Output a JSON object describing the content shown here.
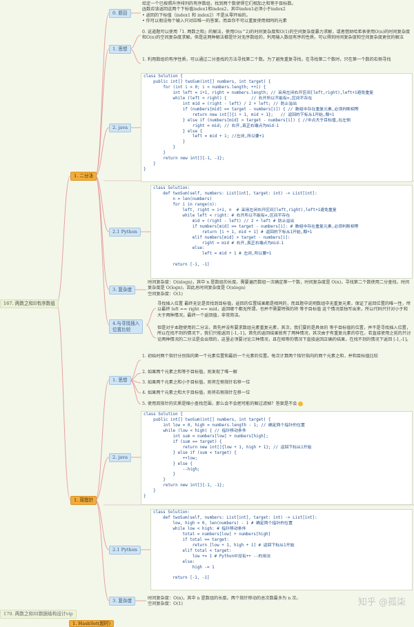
{
  "root": {
    "title": "167. 两数之和II有序数组"
  },
  "branch1": {
    "title": "1. 二分法",
    "question": {
      "label": "0. 题目",
      "line1": "给定一个已按照升序排列的有序数组，找到两个数使得它们相加之和等于目标数。",
      "line2": "函数应该返回这两个下标值index1和index2，其中index1必须小于index2",
      "bullet1": "返回的下标值（index1 和 index2）不是从零开始的。",
      "bullet2": "你可以假设每个输入只对应唯一的答案，而且你不可以重复使用相同的元素"
    },
    "idea": {
      "label": "1. 思想",
      "p0": "0. 这道题可以使用「1. 两数之和」的解法，使用O(n^2)的时间复杂度和O(1)的空间复杂度暴力求解，或者借助哈希表使用O(n)的时间复杂度和O(n)的空间复杂度求解。但是这两种解法都是针对无序数组的，利用输入数组有序的性质，可以得到时间复杂度和空间复杂度更优的解法",
      "p1": "1. 利用数组的有序性质，可以通过二分查找的方法寻找第二个数。为了避免重复寻找，在寻找第二个数时，只在第一个数的右侧寻找"
    },
    "java": {
      "label": "2. java",
      "code": [
        "class Solution {",
        "    public int[] twoSum(int[] numbers, int target) {",
        "        for (int i = 0; i < numbers.length; ++i) {",
        "            int left = i+1, right = numbers.length; // 采用左闭右开区间[left,right),left+1避免重复",
        "            while (left < right) {          // 右开所以不能有=,区间不存在",
        "                int mid = (right - left) / 2 + left; // 防止溢出",
        "                if (numbers[mid] == target - numbers[i]) { // 数组中存在重复元素,必须判断相等",
        "                    return new int[]{i + 1, mid + 1};   // 返回的下标从1开始,都+1",
        "                } else if (numbers[mid] > target - numbers[i]) { //中点大于目标值,在左侧",
        "                    right = mid; // 右开,真正右端点为mid-1",
        "                } else {",
        "                    left = mid + 1; //左闭,所以要+1",
        "                }",
        "            }",
        "        }",
        "        return new int[]{-1, -1};",
        "    }",
        "}"
      ]
    },
    "python": {
      "label": "2.1 Python",
      "code": [
        "class Solution:",
        "    def twoSum(self, numbers: List[int], target: int) -> List[int]:",
        "        n = len(numbers)",
        "        for i in range(n):",
        "            left, right = i+1, n  # 采用左闭右开区间[left,right),left+1避免重复",
        "            while left < right: # 右开所以不能有=,区间不存在",
        "                mid = (right - left) // 2 + left # 防止溢出",
        "                if numbers[mid] == target - numbers[i]: # 数组中存在重复元素,必须判断相等",
        "                    return [i + 1, mid + 1] # 返回的下标从1开始,都+1",
        "                elif numbers[mid] > target - numbers[i]:",
        "                    right = mid # 右开,真正右端点为mid-1",
        "                else:",
        "                    left = mid + 1 # 左闭,所以要+1",
        "",
        "        return [-1, -1]"
      ]
    },
    "complexity": {
      "label": "3. 复杂度",
      "line1": "时间复杂度：O(nlogn)，其中 n 是数组的长度。需要遍历数组一次确定第一个数，时间复杂度是 O(n)，寻找第二个数使用二分查找，时间复杂度是 O(logn)，因此总时间复杂度是 O(nlogn)",
      "line2": "空间复杂度：O(1)"
    },
    "relation": {
      "label_line1": "4.与寻找插入",
      "label_line2": "位置比较",
      "p1": "寻找插入位置 最终无论是否找到目标值，返回的位置结果都是相同的，而且题中说明数组中无重复元素，保证了返回位置的唯一性，所以最终 left == right == mid，返回哪个都无所谓，也并不需要特殊的将 等于目标值 这个情况单独写出来，所以代码只针对小于和大于两种情况，最终一个返回值，非常简洁。",
      "p2": "但是对于本题使用的二分法，首先并没有要求数组元素重复元素，其次，我们要的是具体的 等于目标值的位置，并不是寻找插入位置，所以在找不到的情况下，我们只能返回 [-1,-1]，首先的返回结果就有了两种情况，其次由于有重复元素的存在，若直接使用之前的只讨论两种情况的二分法是会出错的，这里必须要讨论三种情况，且在相等的情况下直接返回正确的结果，在找不到的情况下返回 [-1,-1]。"
    }
  },
  "branch2": {
    "title": "1. 双指针",
    "idea": {
      "label": "1. 思想",
      "s1": "1. 初始时两个指针分别指向第一个元素位置和最后一个元素的位置。每次计算两个指针指向的两个元素之和，并和目标值比较",
      "s2": "2. 如果两个元素之和等于目标值，则发现了唯一解",
      "s3": "3. 如果两个元素之和小于目标值，则将左侧指针右移一位",
      "s4": "4. 如果两个元素之和大于目标值，则将右侧指针左移一位",
      "s5": "5. 使用双指针的实质是缩小查找范围，那么会不会把可能的解过滤掉？答案是不会"
    },
    "java": {
      "label": "2. java",
      "code": [
        "class Solution {",
        "    public int[] twoSum(int[] numbers, int target) {",
        "        int low = 0, high = numbers.length - 1; // 确定两个指针的位置",
        "        while (low < high) { // 指针移动条件",
        "            int sum = numbers[low] + numbers[high];",
        "            if (sum == target) {",
        "                return new int[]{low + 1, high + 1}; // 返回下标从1开始",
        "            } else if (sum < target) {",
        "                ++low;",
        "            } else {",
        "                --high;",
        "            }",
        "        }",
        "        return new int[]{-1, -1};",
        "    }",
        "}"
      ]
    },
    "python": {
      "label": "2.1 Python",
      "code": [
        "class Solution:",
        "    def twoSum(self, numbers: List[int], target: int) -> List[int]:",
        "        low, high = 0, len(numbers) - 1 # 确定两个指针的位置",
        "        while low < high: # 指针移动条件",
        "            total = numbers[low] + numbers[high]",
        "            if total == target:",
        "                return [low + 1, high + 1] # 返回下标从1开始",
        "            elif total < target:",
        "                low += 1 # Python中没有++ --的用法",
        "            else:",
        "                high -= 1",
        "",
        "        return [-1, -1]"
      ]
    },
    "complexity": {
      "label": "3. 复杂度",
      "line1": "时间复杂度：O(n)，其中 n 是数组的长度。两个指针移动的总次数最多为 n 次。",
      "line2": "空间复杂度：O(1)"
    }
  },
  "bottom": {
    "node1": "170. 两数之和III数据结构设计vip",
    "node2": "1. HashSet(超时)"
  },
  "watermark": "知乎 @孤柒",
  "colors": {
    "orange": "#f3ad3c",
    "blue": "#cfe4f4",
    "line": "#e8a0a0",
    "highlight": "#fff35a",
    "red": "#e53935"
  }
}
